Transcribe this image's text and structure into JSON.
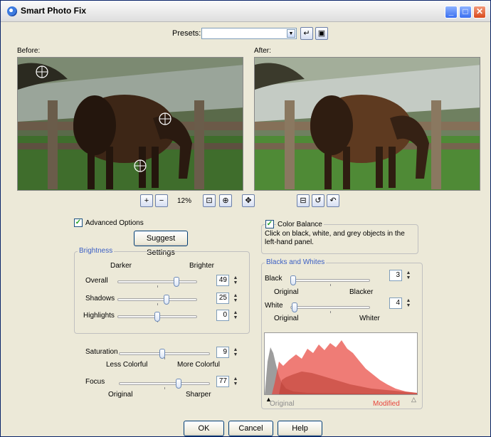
{
  "window": {
    "title": "Smart Photo Fix"
  },
  "presets": {
    "label": "Presets:",
    "value": ""
  },
  "before": {
    "label": "Before:"
  },
  "after": {
    "label": "After:"
  },
  "zoom": {
    "level": "12%"
  },
  "advanced": {
    "label": "Advanced Options",
    "checked": true,
    "suggest_button": "Suggest Settings"
  },
  "brightness": {
    "title": "Brightness",
    "left": "Darker",
    "right": "Brighter",
    "overall": {
      "label": "Overall",
      "value": "49"
    },
    "shadows": {
      "label": "Shadows",
      "value": "25"
    },
    "highlights": {
      "label": "Highlights",
      "value": "0"
    }
  },
  "saturation": {
    "label": "Saturation",
    "value": "9",
    "left": "Less Colorful",
    "right": "More Colorful"
  },
  "focus": {
    "label": "Focus",
    "value": "77",
    "left": "Original",
    "right": "Sharper"
  },
  "color_balance": {
    "label": "Color Balance",
    "checked": true,
    "hint": "Click on black, white, and grey objects in the left-hand panel."
  },
  "blacks_whites": {
    "title": "Blacks and Whites",
    "black": {
      "label": "Black",
      "value": "3",
      "left": "Original",
      "right": "Blacker"
    },
    "white": {
      "label": "White",
      "value": "4",
      "left": "Original",
      "right": "Whiter"
    }
  },
  "histogram": {
    "original_label": "Original",
    "modified_label": "Modified",
    "modified_color": "#e8453c",
    "original_color": "#8c8c8c"
  },
  "buttons": {
    "ok": "OK",
    "cancel": "Cancel",
    "help": "Help"
  }
}
